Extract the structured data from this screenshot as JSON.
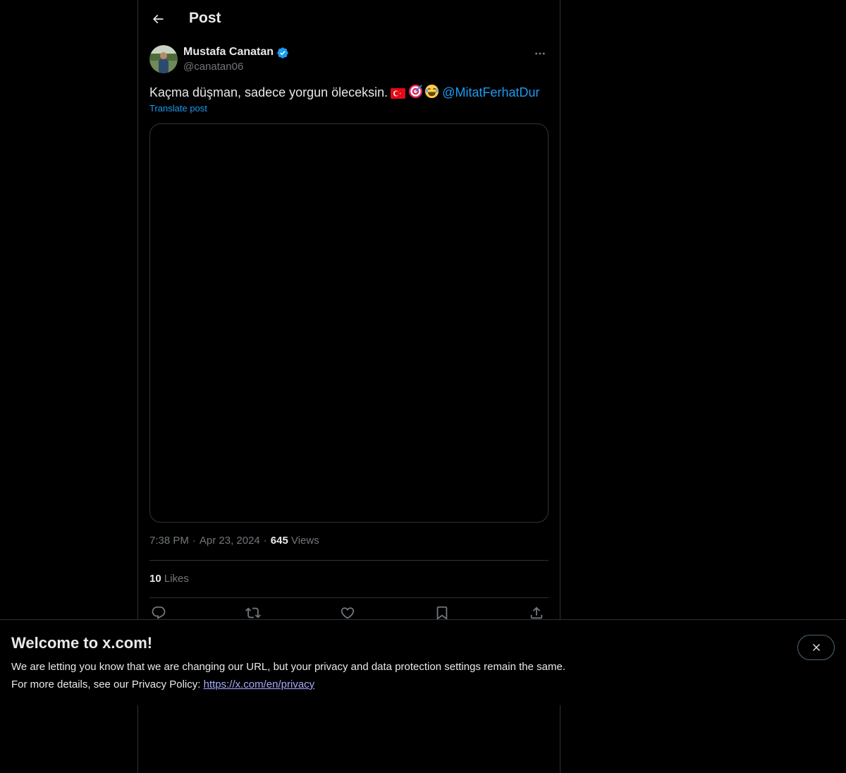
{
  "header": {
    "title": "Post",
    "back_icon": "arrow-left-icon"
  },
  "post": {
    "author": {
      "name": "Mustafa Canatan",
      "handle": "@canatan06",
      "verified": true
    },
    "text": "Kaçma düşman, sadece yorgun öleceksin.",
    "emojis": [
      "🇹🇷",
      "🎯",
      "😂"
    ],
    "mention": "@MitatFerhatDur",
    "translate_label": "Translate post",
    "time": "7:38 PM",
    "date": "Apr 23, 2024",
    "separator": "·",
    "views_count": "645",
    "views_label": "Views",
    "likes_count": "10",
    "likes_label": "Likes"
  },
  "actions": [
    "reply-icon",
    "repost-icon",
    "like-icon",
    "bookmark-icon",
    "share-icon"
  ],
  "banner": {
    "title": "Welcome to x.com!",
    "line1": "We are letting you know that we are changing our URL, but your privacy and data protection settings remain the same.",
    "line2_prefix": "For more details, see our Privacy Policy:",
    "link": "https://x.com/en/privacy"
  },
  "colors": {
    "accent": "#1d9bf0",
    "background": "#000000",
    "border": "#2f3336",
    "secondary_text": "#71767b"
  }
}
